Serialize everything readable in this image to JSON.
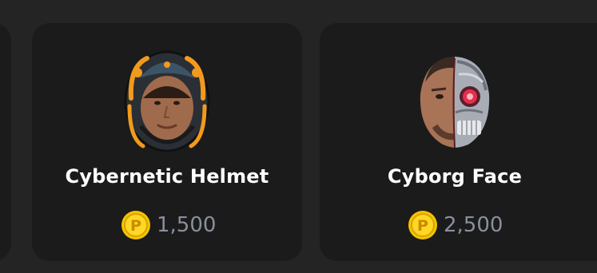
{
  "items": [
    {
      "name": "Cybernetic Helmet",
      "price": "1,500",
      "icon": "cybernetic-helmet-avatar"
    },
    {
      "name": "Cyborg Face",
      "price": "2,500",
      "icon": "cyborg-face-avatar"
    }
  ],
  "coin_icon": "coin-p-icon",
  "colors": {
    "background": "#242424",
    "card": "#1b1b1b",
    "name_text": "#ffffff",
    "price_text": "#8a8f9c",
    "coin": "#f5c400"
  }
}
